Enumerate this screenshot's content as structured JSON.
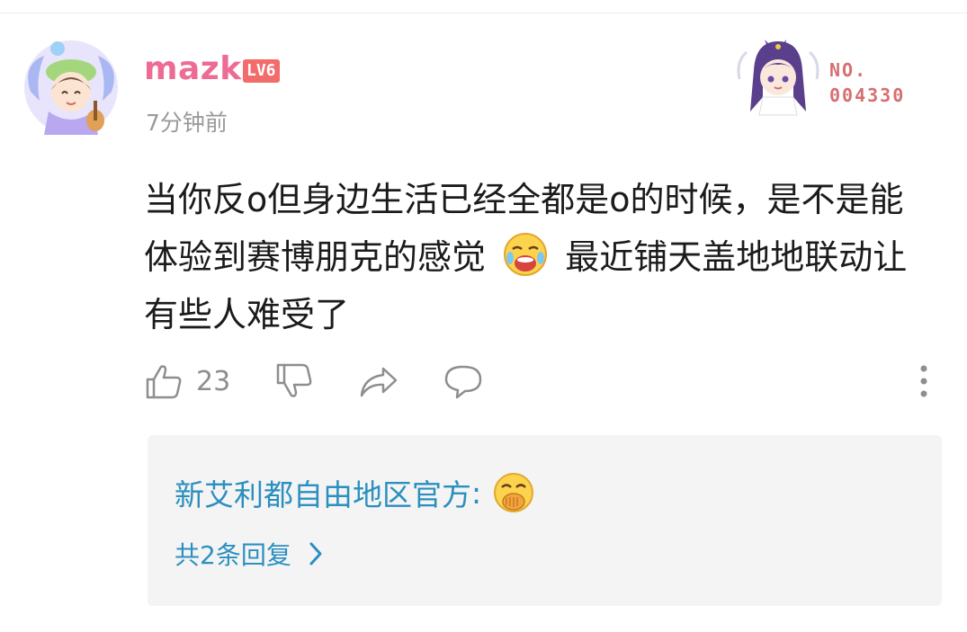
{
  "comment": {
    "username": "mazk",
    "level": "LV6",
    "timestamp": "7分钟前",
    "fan_badge_number_label": "NO.",
    "fan_badge_number": "004330",
    "text_part1": "当你反o但身边生活已经全都是o的时候，是不是能体验到赛博朋克的感觉",
    "text_part2": "最近铺天盖地地联动让有些人难受了",
    "like_count": "23",
    "username_color": "#ee6b93",
    "accent_blue": "#2b8fbf"
  },
  "icons": {
    "like": "thumbs-up-icon",
    "dislike": "thumbs-down-icon",
    "share": "share-icon",
    "comment": "comment-icon",
    "more": "more-vertical-icon",
    "reply_arrow": "chevron-right-icon"
  },
  "reply_preview": {
    "author": "新艾利都自由地区官方",
    "separator": ":",
    "count_text": "共2条回复"
  }
}
